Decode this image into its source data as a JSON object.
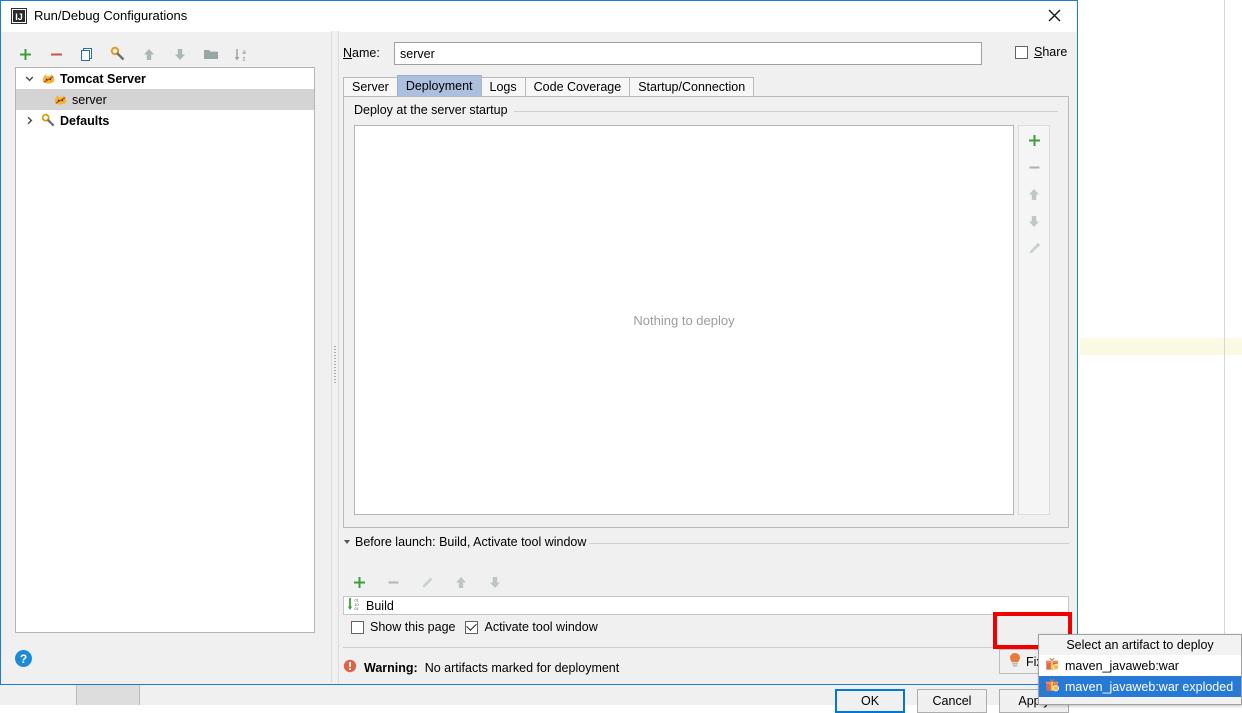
{
  "window": {
    "title": "Run/Debug Configurations",
    "app_icon": "intellij-idea-icon",
    "close_icon": "close-icon"
  },
  "left_panel": {
    "toolbar": [
      {
        "name": "add-configuration-button",
        "icon": "plus-icon",
        "label": "+"
      },
      {
        "name": "remove-configuration-button",
        "icon": "minus-icon",
        "label": "−"
      },
      {
        "name": "copy-configuration-button",
        "icon": "copy-icon",
        "label": ""
      },
      {
        "name": "edit-defaults-button",
        "icon": "wrench-icon",
        "label": ""
      },
      {
        "name": "move-up-button",
        "icon": "arrow-up-icon",
        "label": ""
      },
      {
        "name": "move-down-button",
        "icon": "arrow-down-icon",
        "label": ""
      },
      {
        "name": "create-folder-button",
        "icon": "folder-icon",
        "label": ""
      },
      {
        "name": "sort-configurations-button",
        "icon": "sort-alpha-icon",
        "label": ""
      }
    ],
    "tree": [
      {
        "label": "Tomcat Server",
        "icon": "tomcat-icon",
        "expanded": true,
        "bold": true,
        "selected": false,
        "child": false
      },
      {
        "label": "server",
        "icon": "tomcat-icon",
        "expanded": null,
        "bold": false,
        "selected": true,
        "child": true
      },
      {
        "label": "Defaults",
        "icon": "wrench-icon",
        "expanded": false,
        "bold": true,
        "selected": false,
        "child": false
      }
    ],
    "help_button_label": "?"
  },
  "right_panel": {
    "name_label": "Name:",
    "name_value": "server",
    "name_placeholder": "",
    "share_label": "Share",
    "share_checked": false,
    "tabs": [
      {
        "label": "Server",
        "active": false
      },
      {
        "label": "Deployment",
        "active": true
      },
      {
        "label": "Logs",
        "active": false
      },
      {
        "label": "Code Coverage",
        "active": false
      },
      {
        "label": "Startup/Connection",
        "active": false
      }
    ],
    "deployment": {
      "group_title": "Deploy at the server startup",
      "empty_text": "Nothing to deploy",
      "side_toolbar": [
        {
          "name": "add-artifact-button",
          "icon": "plus-icon"
        },
        {
          "name": "remove-artifact-button",
          "icon": "minus-icon"
        },
        {
          "name": "move-artifact-up-button",
          "icon": "arrow-up-icon"
        },
        {
          "name": "move-artifact-down-button",
          "icon": "arrow-down-icon"
        },
        {
          "name": "edit-artifact-button",
          "icon": "pencil-icon"
        }
      ]
    },
    "before_launch": {
      "title": "Before launch: Build, Activate tool window",
      "toolbar": [
        {
          "name": "add-task-button",
          "icon": "plus-icon"
        },
        {
          "name": "remove-task-button",
          "icon": "minus-icon"
        },
        {
          "name": "edit-task-button",
          "icon": "pencil-icon"
        },
        {
          "name": "move-task-up-button",
          "icon": "arrow-up-icon"
        },
        {
          "name": "move-task-down-button",
          "icon": "arrow-down-icon"
        }
      ],
      "items": [
        {
          "label": "Build",
          "icon": "build-icon"
        }
      ],
      "checkboxes": [
        {
          "label": "Show this page",
          "checked": false
        },
        {
          "label": "Activate tool window",
          "checked": true
        }
      ]
    },
    "warning": {
      "icon": "error-icon",
      "prefix": "Warning:",
      "text": "No artifacts marked for deployment"
    },
    "fix_button": {
      "label": "Fix",
      "icon": "lightbulb-icon"
    },
    "buttons": [
      {
        "label": "OK",
        "default": true
      },
      {
        "label": "Cancel",
        "default": false
      },
      {
        "label": "Apply",
        "default": false
      }
    ]
  },
  "popup_menu": {
    "header": "Select an artifact to deploy",
    "items": [
      {
        "label": "maven_javaweb:war",
        "icon": "artifact-icon",
        "selected": false
      },
      {
        "label": "maven_javaweb:war exploded",
        "icon": "artifact-exploded-icon",
        "selected": true
      }
    ]
  },
  "annotation": {
    "name": "red-highlight-rectangle",
    "color": "#f00000"
  },
  "colors": {
    "dialog_border": "#1e7ad6",
    "active_tab": "#adbfdf",
    "selection": "#2779d6",
    "default_button_border": "#0078d7",
    "warning_icon": "#d9654b",
    "accent_green": "#3c9e3c",
    "highlight_line": "#fbf8e4"
  }
}
